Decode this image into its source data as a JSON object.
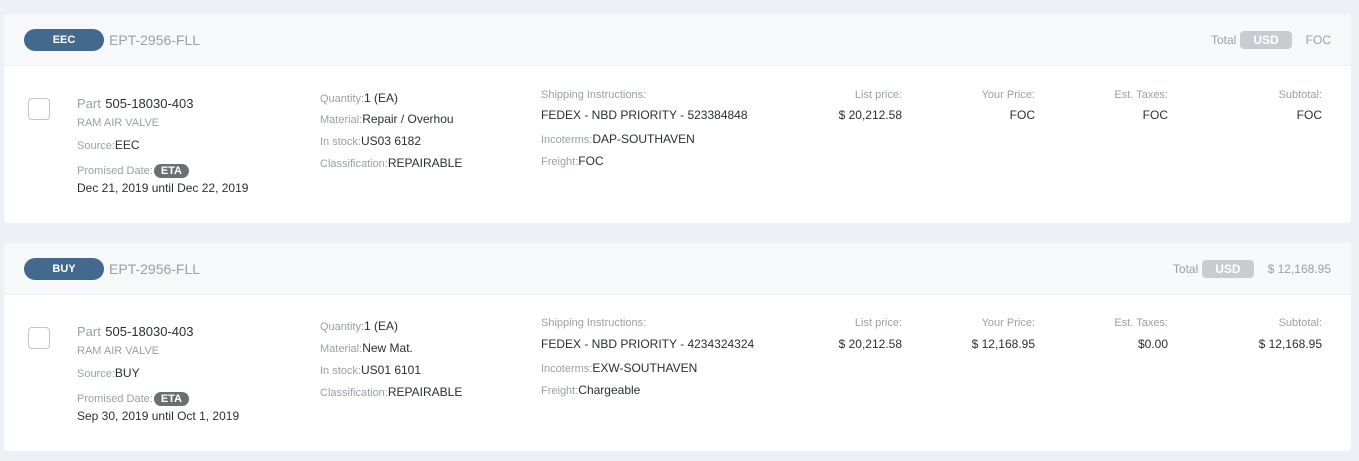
{
  "orders": [
    {
      "pill": "EEC",
      "order_no": "EPT-2956-FLL",
      "total_label": "Total",
      "currency": "USD",
      "total_value": "FOC",
      "part_label": "Part",
      "part_no": "505-18030-403",
      "description": "RAM AIR VALVE",
      "source_label": "Source:",
      "source": "EEC",
      "promised_label": "Promised Date:",
      "eta": "ETA",
      "promised_dates": "Dec 21, 2019 until Dec 22, 2019",
      "quantity_label": "Quantity:",
      "quantity": "1 (EA)",
      "material_label": "Material:",
      "material": "Repair / Overhou",
      "stock_label": "In stock:",
      "stock": "US03 6182",
      "class_label": "Classification:",
      "classification": "REPAIRABLE",
      "shipping_label": "Shipping Instructions:",
      "shipping": "FEDEX - NBD PRIORITY - 523384848",
      "incoterms_label": "Incoterms:",
      "incoterms": "DAP-SOUTHAVEN",
      "freight_label": "Freight:",
      "freight": "FOC",
      "list_price_label": "List price:",
      "list_price": "$ 20,212.58",
      "your_price_label": "Your Price:",
      "your_price": "FOC",
      "taxes_label": "Est. Taxes:",
      "taxes": "FOC",
      "subtotal_label": "Subtotal:",
      "subtotal": "FOC"
    },
    {
      "pill": "BUY",
      "order_no": "EPT-2956-FLL",
      "total_label": "Total",
      "currency": "USD",
      "total_value": "$ 12,168.95",
      "part_label": "Part",
      "part_no": "505-18030-403",
      "description": "RAM AIR VALVE",
      "source_label": "Source:",
      "source": "BUY",
      "promised_label": "Promised Date:",
      "eta": "ETA",
      "promised_dates": "Sep 30, 2019 until Oct 1, 2019",
      "quantity_label": "Quantity:",
      "quantity": "1 (EA)",
      "material_label": "Material:",
      "material": "New Mat.",
      "stock_label": "In stock:",
      "stock": "US01 6101",
      "class_label": "Classification:",
      "classification": "REPAIRABLE",
      "shipping_label": "Shipping Instructions:",
      "shipping": "FEDEX - NBD PRIORITY - 4234324324",
      "incoterms_label": "Incoterms:",
      "incoterms": "EXW-SOUTHAVEN",
      "freight_label": "Freight:",
      "freight": "Chargeable",
      "list_price_label": "List price:",
      "list_price": "$ 20,212.58",
      "your_price_label": "Your Price:",
      "your_price": "$ 12,168.95",
      "taxes_label": "Est. Taxes:",
      "taxes": "$0.00",
      "subtotal_label": "Subtotal:",
      "subtotal": "$ 12,168.95"
    }
  ],
  "colors": {
    "pill": "#43698f",
    "page_bg": "#edf1f5",
    "eta_badge": "#6b6f73",
    "currency_badge": "#c8ccd0"
  }
}
